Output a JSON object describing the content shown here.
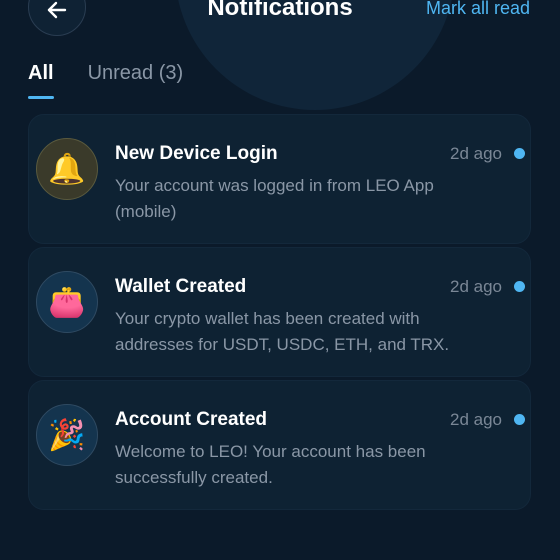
{
  "header": {
    "title": "Notifications",
    "mark_all": "Mark all read",
    "back_icon": "arrow-left-icon"
  },
  "tabs": [
    {
      "label": "All",
      "active": true
    },
    {
      "label": "Unread (3)",
      "active": false
    }
  ],
  "notifications": [
    {
      "icon": "🔔",
      "icon_name": "bell-icon",
      "title": "New Device Login",
      "time": "2d ago",
      "body": "Your account was logged in from LEO App (mobile)",
      "unread": true
    },
    {
      "icon": "👛",
      "icon_name": "purse-icon",
      "title": "Wallet Created",
      "time": "2d ago",
      "body": "Your crypto wallet has been created with addresses for USDT, USDC, ETH, and TRX.",
      "unread": true
    },
    {
      "icon": "🎉",
      "icon_name": "party-popper-icon",
      "title": "Account Created",
      "time": "2d ago",
      "body": "Welcome to LEO! Your account has been successfully created.",
      "unread": true
    }
  ],
  "colors": {
    "background": "#0b1a2a",
    "card": "#0e2233",
    "accent": "#4fb6f2",
    "muted": "#8a97a6"
  }
}
